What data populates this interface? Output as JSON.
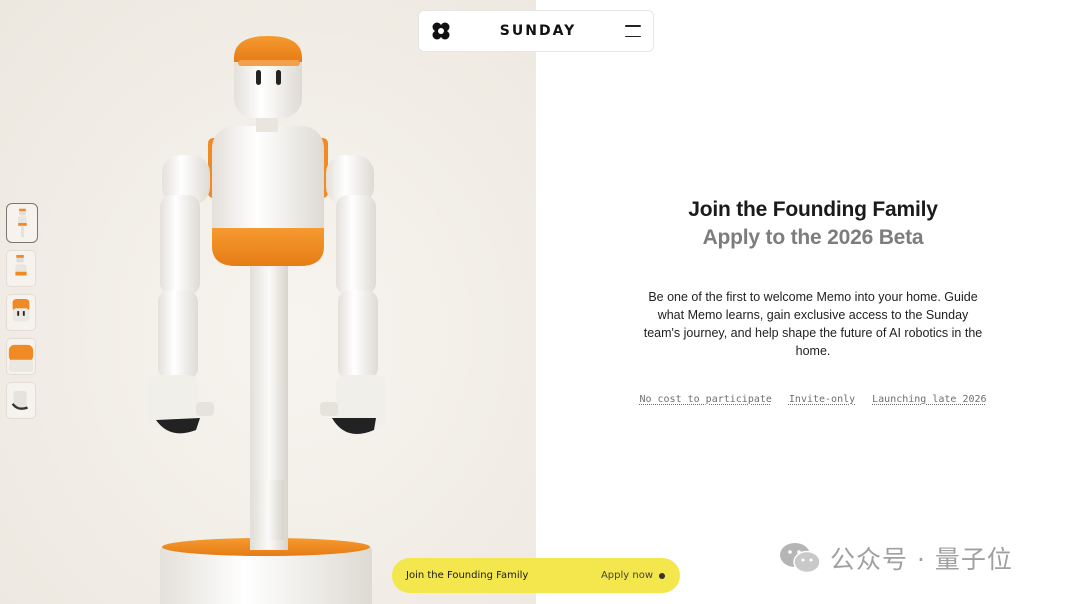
{
  "header": {
    "brand": "SUNDAY",
    "logo_icon": "flower-logo-icon",
    "menu_icon": "hamburger-menu-icon"
  },
  "gallery": {
    "thumbnails": [
      {
        "name": "thumb-full-robot",
        "active": true
      },
      {
        "name": "thumb-side-view",
        "active": false
      },
      {
        "name": "thumb-head-closeup",
        "active": false
      },
      {
        "name": "thumb-cap-closeup",
        "active": false
      },
      {
        "name": "thumb-hand-closeup",
        "active": false
      }
    ]
  },
  "main": {
    "title": "Join the Founding Family",
    "subtitle": "Apply to the 2026 Beta",
    "description": "Be one of the first to welcome Memo into your home. Guide what Memo learns, gain exclusive access to the Sunday team's journey, and help shape the future of AI robotics in the home.",
    "tags": [
      "No cost to participate",
      "Invite-only",
      "Launching late 2026"
    ]
  },
  "cta": {
    "label": "Join the Founding Family",
    "action": "Apply now"
  },
  "watermark": {
    "text": "公众号 · 量子位"
  },
  "colors": {
    "accent_yellow": "#f4e64d",
    "robot_orange": "#ef8a24",
    "panel_bg": "#f3efe9"
  }
}
